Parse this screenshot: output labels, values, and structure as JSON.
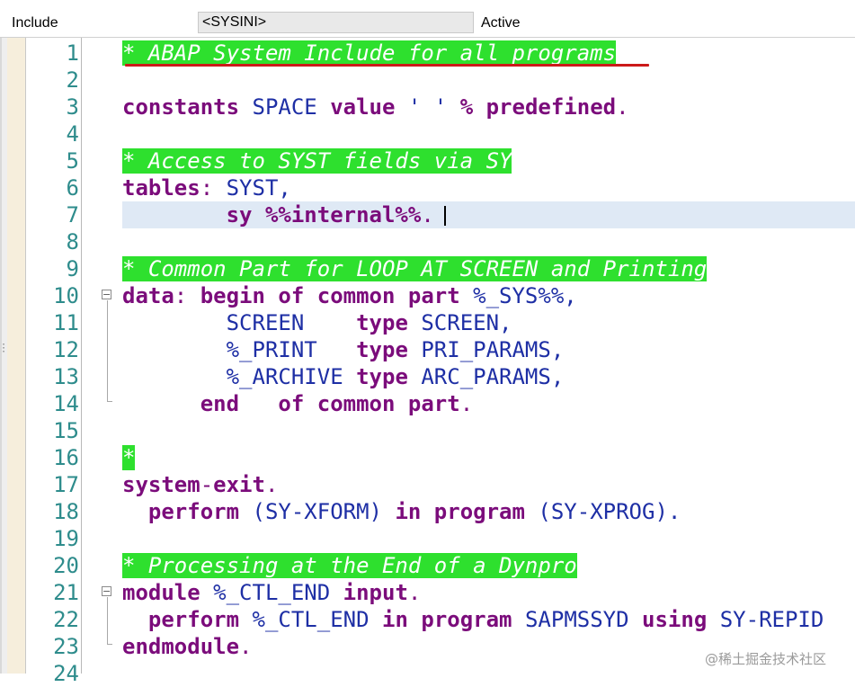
{
  "header": {
    "label": "Include",
    "program_name": "<SYSINI>",
    "status": "Active"
  },
  "gutter": {
    "line_numbers": [
      "1",
      "2",
      "3",
      "4",
      "5",
      "6",
      "7",
      "8",
      "9",
      "10",
      "11",
      "12",
      "13",
      "14",
      "15",
      "16",
      "17",
      "18",
      "19",
      "20",
      "21",
      "22",
      "23",
      "24"
    ]
  },
  "code": {
    "l1": {
      "comment": "* ABAP System Include for all programs"
    },
    "l3": {
      "k1": "constants",
      "t1": " SPACE ",
      "k2": "value",
      "t2": " ' ' ",
      "k3": "% predefined",
      "p": "."
    },
    "l5": {
      "comment": "* Access to SYST fields via SY"
    },
    "l6": {
      "k1": "tables",
      "p1": ":",
      "t1": " SYST,"
    },
    "l7": {
      "t0": "        ",
      "k1": "sy %%internal%%",
      "p": "."
    },
    "l9": {
      "comment": "* Common Part for LOOP AT SCREEN and Printing"
    },
    "l10": {
      "k1": "data",
      "p1": ":",
      "k2": " begin of common part",
      "t1": " %_SYS%%,"
    },
    "l11": {
      "t0": "        SCREEN    ",
      "k1": "type",
      "t1": " SCREEN,"
    },
    "l12": {
      "t0": "        %_PRINT   ",
      "k1": "type",
      "t1": " PRI_PARAMS,"
    },
    "l13": {
      "t0": "        %_ARCHIVE ",
      "k1": "type",
      "t1": " ARC_PARAMS,"
    },
    "l14": {
      "t0": "      ",
      "k1": "end   of common part",
      "p": "."
    },
    "l16": {
      "comment": "*"
    },
    "l17": {
      "k1": "system",
      "p1": "-",
      "k2": "exit",
      "p": "."
    },
    "l18": {
      "t0": "  ",
      "k1": "perform",
      "t1": " (SY-XFORM) ",
      "k2": "in program",
      "t2": " (SY-XPROG)."
    },
    "l20": {
      "comment": "* Processing at the End of a Dynpro"
    },
    "l21": {
      "k1": "module",
      "t1": " %_CTL_END ",
      "k2": "input",
      "p": "."
    },
    "l22": {
      "t0": "  ",
      "k1": "perform",
      "t1": " %_CTL_END ",
      "k2": "in program",
      "t2": " SAPMSSYD ",
      "k3": "using",
      "t3": " SY-REPID"
    },
    "l23": {
      "k1": "endmodule",
      "p": "."
    }
  },
  "watermark": "@稀土掘金技术社区",
  "colors": {
    "keyword": "#7b0c7b",
    "text": "#1e2fa5",
    "comment_bg": "#2ee02e",
    "line_number": "#2e8c8c",
    "current_line": "#dfe9f5",
    "underline": "#cc1a1a"
  }
}
